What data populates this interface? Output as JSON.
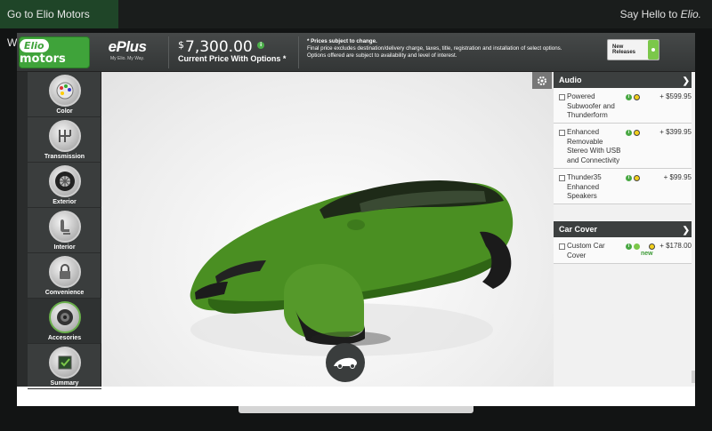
{
  "topbar": {
    "site_link": "Go to Elio Motors Website",
    "hello_prefix": "Say Hello to ",
    "hello_name": "Elio."
  },
  "header": {
    "logo_oval": "Elio",
    "logo_text": "motors",
    "eplus_title": "ePlus",
    "eplus_sub": "My Elio. My Way.",
    "price_currency": "$",
    "price_value": "7,300.00",
    "price_label": "Current Price With Options *",
    "notes_title": "* Prices subject to change.",
    "notes_line1": "Final price excludes destination/delivery charge, taxes, title, registration and installation of select options.",
    "notes_line2": "Options offered are subject to availability and level of interest.",
    "new_releases": "New Releases"
  },
  "sidebar": {
    "items": [
      {
        "label": "Color"
      },
      {
        "label": "Transmission"
      },
      {
        "label": "Exterior"
      },
      {
        "label": "Interior"
      },
      {
        "label": "Convenience"
      },
      {
        "label": "Accesories"
      },
      {
        "label": "Summary"
      }
    ]
  },
  "viewer": {
    "car_color": "#4a8f22"
  },
  "panel": {
    "sections": [
      {
        "title": "Audio",
        "options": [
          {
            "name": "Powered Subwoofer and Thunderform",
            "price": "+ $599.95",
            "checked": false
          },
          {
            "name": "Enhanced Removable Stereo With USB and Connectivity",
            "price": "+ $399.95",
            "checked": false
          },
          {
            "name": "Thunder35 Enhanced Speakers",
            "price": "+ $99.95",
            "checked": false
          }
        ]
      },
      {
        "title": "Car Cover",
        "options": [
          {
            "name": "Custom Car Cover",
            "price": "+ $178.00",
            "badge": "new",
            "checked": false
          }
        ]
      }
    ]
  },
  "colors": {
    "accent_green": "#3fa33a",
    "header_dark": "#3c3f3f"
  }
}
